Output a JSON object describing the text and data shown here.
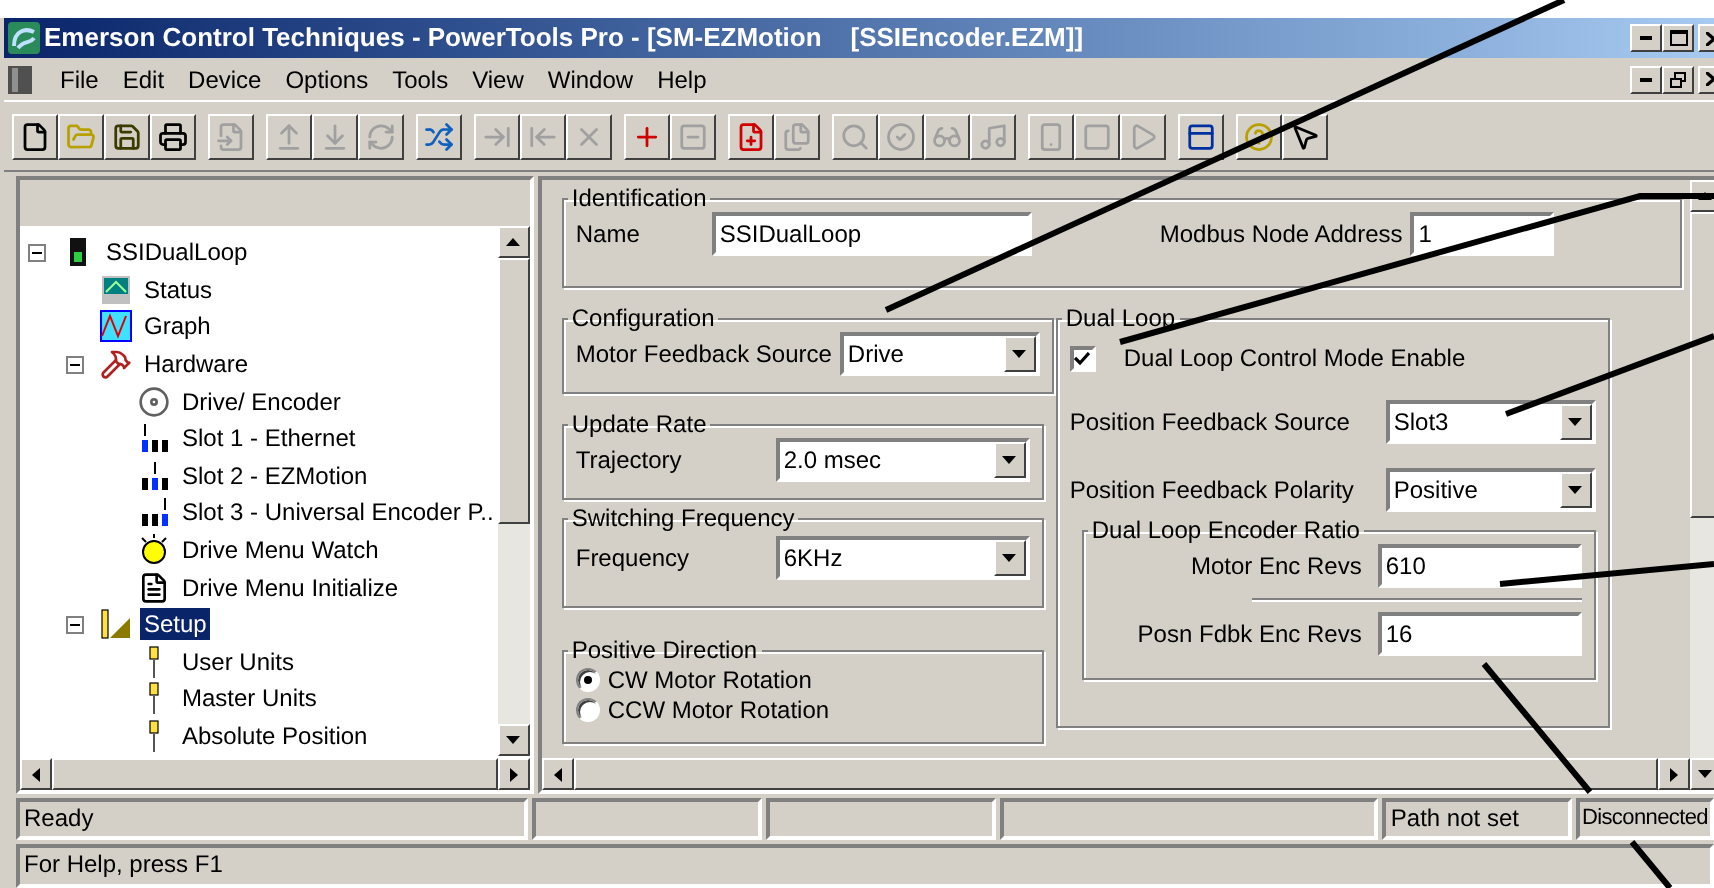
{
  "window": {
    "title": "Emerson Control Techniques - PowerTools Pro - [SM-EZMotion    [SSIEncoder.EZM]]"
  },
  "menu": [
    "File",
    "Edit",
    "Device",
    "Options",
    "Tools",
    "View",
    "Window",
    "Help"
  ],
  "toolbar": [
    [
      {
        "disabled": false
      },
      {
        "disabled": false
      },
      {
        "disabled": false
      },
      {
        "disabled": false
      }
    ],
    [
      {
        "disabled": true
      }
    ],
    [
      {
        "disabled": true
      },
      {
        "disabled": true
      },
      {
        "disabled": true
      }
    ],
    [
      {
        "disabled": false
      }
    ],
    [
      {
        "disabled": true
      },
      {
        "disabled": true
      },
      {
        "disabled": true
      }
    ],
    [
      {
        "disabled": false
      },
      {
        "disabled": true
      }
    ],
    [
      {
        "disabled": false
      },
      {
        "disabled": true
      }
    ],
    [
      {
        "disabled": true
      },
      {
        "disabled": true
      },
      {
        "disabled": true
      },
      {
        "disabled": true
      }
    ],
    [
      {
        "disabled": true
      },
      {
        "disabled": true
      },
      {
        "disabled": true
      }
    ],
    [
      {
        "disabled": false
      }
    ],
    [
      {
        "disabled": false
      },
      {
        "disabled": false
      }
    ]
  ],
  "tree": [
    {
      "label": "SSIDualLoop",
      "kind": "device",
      "expanded": true,
      "selected": false,
      "children": [
        {
          "label": "Status",
          "kind": "status",
          "selected": false
        },
        {
          "label": "Graph",
          "kind": "graph",
          "selected": false
        },
        {
          "label": "Hardware",
          "kind": "hardware",
          "expanded": true,
          "selected": false,
          "children": [
            {
              "label": "Drive/ Encoder",
              "kind": "drive",
              "selected": false
            },
            {
              "label": "Slot 1 - Ethernet",
              "kind": "slot1",
              "selected": false
            },
            {
              "label": "Slot 2 - EZMotion",
              "kind": "slot2",
              "selected": false
            },
            {
              "label": "Slot 3 - Universal Encoder P..",
              "kind": "slot3",
              "selected": false
            },
            {
              "label": "Drive Menu Watch",
              "kind": "watch",
              "selected": false
            },
            {
              "label": "Drive Menu Initialize",
              "kind": "init",
              "selected": false
            }
          ]
        },
        {
          "label": "Setup",
          "kind": "setup",
          "expanded": true,
          "selected": true,
          "children": [
            {
              "label": "User Units",
              "kind": "unit",
              "selected": false
            },
            {
              "label": "Master Units",
              "kind": "unit",
              "selected": false
            },
            {
              "label": "Absolute Position",
              "kind": "unit",
              "selected": false
            }
          ]
        }
      ]
    }
  ],
  "form": {
    "identification": {
      "title": "Identification",
      "name_label": "Name",
      "name_value": "SSIDualLoop",
      "modbus_label": "Modbus Node Address",
      "modbus_value": "1"
    },
    "configuration": {
      "title": "Configuration",
      "label": "Motor Feedback Source",
      "value": "Drive"
    },
    "update_rate": {
      "title": "Update Rate",
      "label": "Trajectory",
      "value": "2.0 msec"
    },
    "switching_frequency": {
      "title": "Switching Frequency",
      "label": "Frequency",
      "value": "6KHz"
    },
    "positive_direction": {
      "title": "Positive Direction",
      "options": [
        {
          "label": "CW Motor Rotation",
          "selected": true
        },
        {
          "label": "CCW Motor Rotation",
          "selected": false
        }
      ]
    },
    "dual_loop": {
      "title": "Dual Loop",
      "enable": {
        "label": "Dual Loop Control Mode Enable",
        "checked": true
      },
      "feedback_source": {
        "label": "Position Feedback Source",
        "value": "Slot3"
      },
      "feedback_polarity": {
        "label": "Position Feedback Polarity",
        "value": "Positive"
      },
      "ratio": {
        "title": "Dual Loop Encoder Ratio",
        "motor_label": "Motor Enc Revs",
        "motor_value": "610",
        "posn_label": "Posn Fdbk Enc Revs",
        "posn_value": "16"
      }
    }
  },
  "status_bar": {
    "ready": "Ready",
    "path": "Path not set",
    "connection": "Disconnected"
  },
  "help_bar": "For Help, press F1"
}
